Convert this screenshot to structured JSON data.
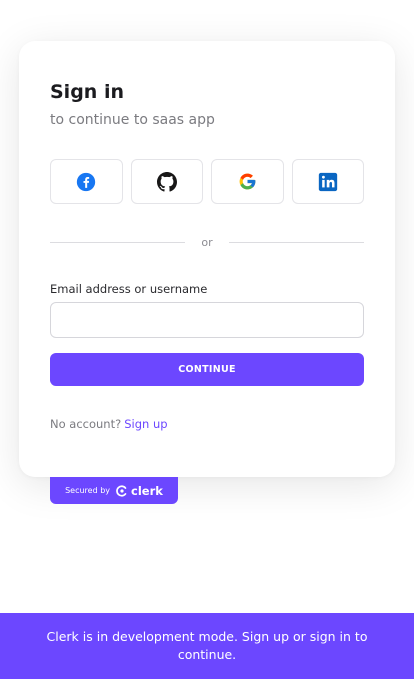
{
  "card": {
    "title": "Sign in",
    "subtitle": "to continue to saas app"
  },
  "social": [
    {
      "name": "facebook",
      "color": "#1877F2"
    },
    {
      "name": "github",
      "color": "#181717"
    },
    {
      "name": "google",
      "color": "#4285F4"
    },
    {
      "name": "linkedin",
      "color": "#0A66C2"
    }
  ],
  "divider": {
    "text": "or"
  },
  "email": {
    "label": "Email address or username",
    "value": "",
    "placeholder": ""
  },
  "continue_label": "CONTINUE",
  "footer": {
    "no_account": "No account?",
    "signup": "Sign up"
  },
  "secured": {
    "by": "Secured by",
    "brand": "clerk"
  },
  "dev_banner": "Clerk is in development mode. Sign up or sign in to continue.",
  "colors": {
    "accent": "#6c47ff",
    "banner": "#6c47ff"
  }
}
